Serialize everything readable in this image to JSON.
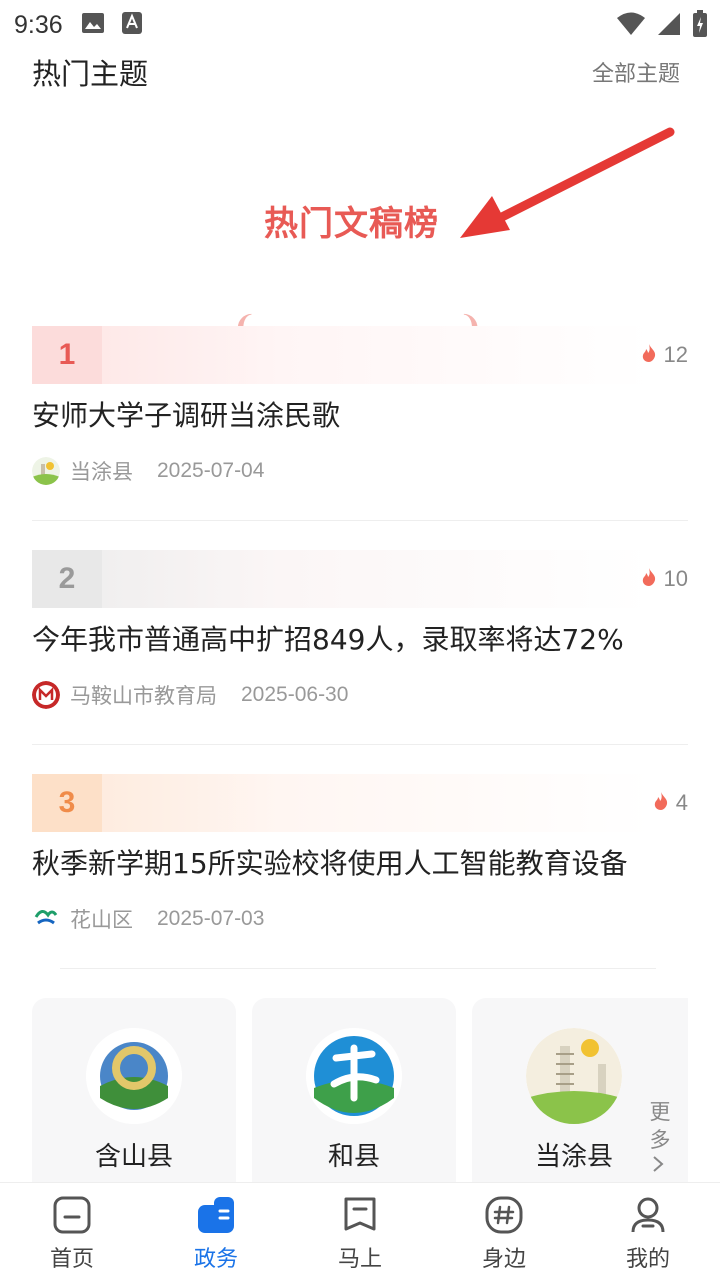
{
  "status_bar": {
    "time": "9:36"
  },
  "header": {
    "title": "热门主题",
    "all_link": "全部主题"
  },
  "banner": {
    "title": "热门文稿榜"
  },
  "ranking": [
    {
      "rank": "1",
      "heat": "12",
      "title": "安师大学子调研当涂民歌",
      "source": "当涂县",
      "date": "2025-07-04"
    },
    {
      "rank": "2",
      "heat": "10",
      "title": "今年我市普通高中扩招849人，录取率将达72%",
      "source": "马鞍山市教育局",
      "date": "2025-06-30"
    },
    {
      "rank": "3",
      "heat": "4",
      "title": "秋季新学期15所实验校将使用人工智能教育设备",
      "source": "花山区",
      "date": "2025-07-03"
    }
  ],
  "regions": [
    {
      "name": "含山县"
    },
    {
      "name": "和县"
    },
    {
      "name": "当涂县"
    }
  ],
  "more_label": "更多",
  "tabs": [
    {
      "label": "首页",
      "icon": "home-icon"
    },
    {
      "label": "政务",
      "icon": "government-icon"
    },
    {
      "label": "马上",
      "icon": "bookmark-icon"
    },
    {
      "label": "身边",
      "icon": "hashtag-icon"
    },
    {
      "label": "我的",
      "icon": "profile-icon"
    }
  ],
  "colors": {
    "accent": "#1a73e8",
    "banner_red": "#e85a55",
    "rank1": "#e85a55",
    "rank2": "#9a9a9a",
    "rank3": "#f08c4a",
    "fire": "#f26b5b"
  }
}
